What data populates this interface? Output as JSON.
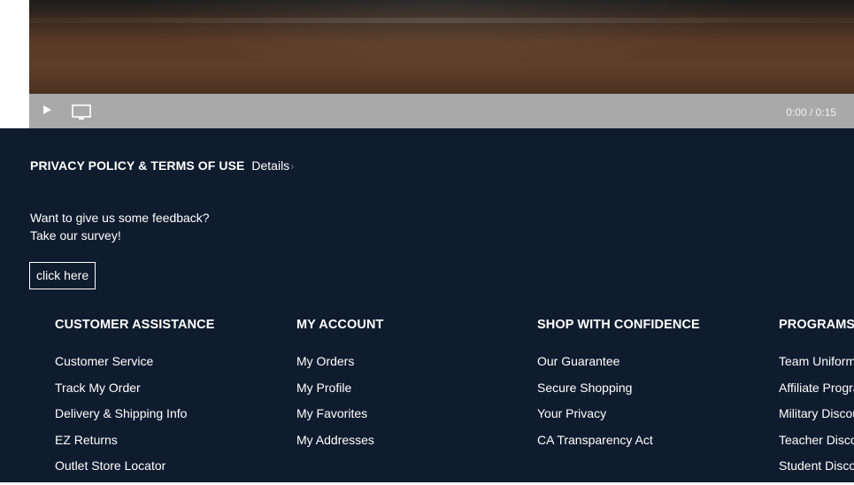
{
  "video": {
    "time_display": "0:00 / 0:15",
    "play_icon": "play-icon",
    "screen_icon": "monitor-icon"
  },
  "privacy": {
    "title": "PRIVACY POLICY & TERMS OF USE",
    "details_label": "Details",
    "chevron": "›"
  },
  "feedback": {
    "line1": "Want to give us some feedback?",
    "line2": "Take our survey!",
    "button_label": "click here"
  },
  "columns": [
    {
      "heading": "CUSTOMER ASSISTANCE",
      "links": [
        "Customer Service",
        "Track My Order",
        "Delivery & Shipping Info",
        "EZ Returns",
        "Outlet Store Locator"
      ]
    },
    {
      "heading": "MY ACCOUNT",
      "links": [
        "My Orders",
        "My Profile",
        "My Favorites",
        "My Addresses"
      ]
    },
    {
      "heading": "SHOP WITH CONFIDENCE",
      "links": [
        "Our Guarantee",
        "Secure Shopping",
        "Your Privacy",
        "CA Transparency Act"
      ]
    },
    {
      "heading": "PROGRAMS",
      "links": [
        "Team Uniforms",
        "Affiliate Program",
        "Military Discount",
        "Teacher Discount",
        "Student Discount"
      ]
    }
  ],
  "colors": {
    "footer_bg": "#0f1c2e",
    "controls_bg": "#a9a9a9",
    "text": "#ffffff"
  }
}
